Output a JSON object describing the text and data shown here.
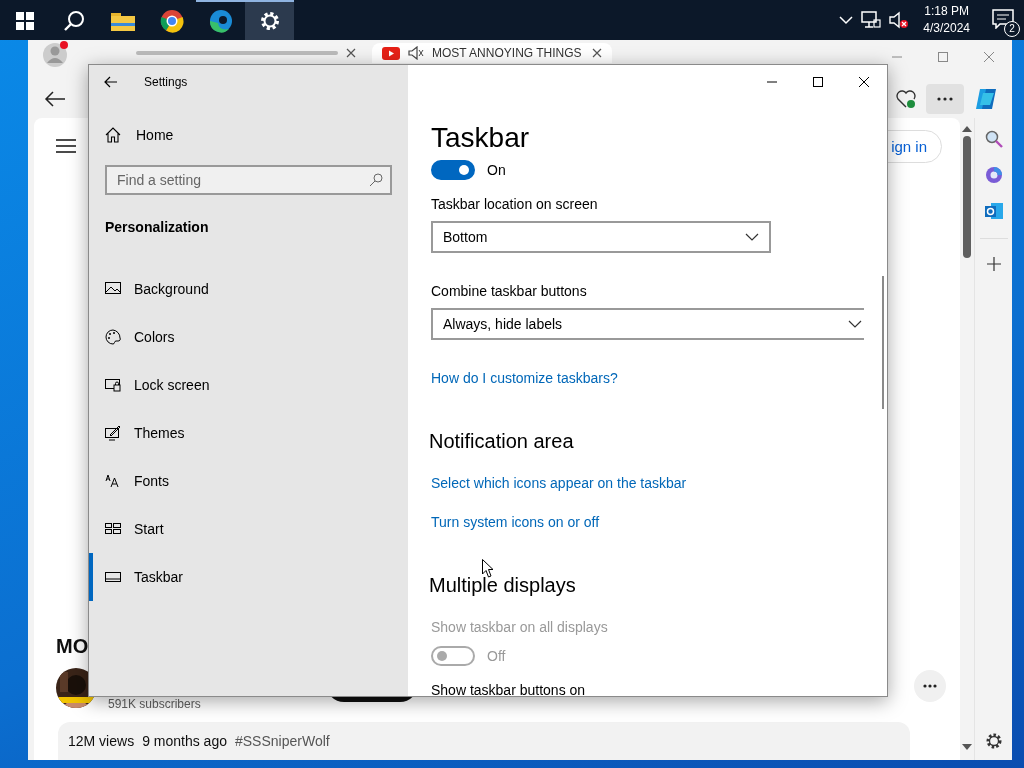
{
  "os_taskbar": {
    "apps": [
      {
        "kind": "start",
        "open": false,
        "active": false
      },
      {
        "kind": "search",
        "open": false,
        "active": false
      },
      {
        "kind": "folder",
        "open": false,
        "active": false
      },
      {
        "kind": "chrome",
        "open": false,
        "active": false
      },
      {
        "kind": "edge",
        "open": true,
        "active": false
      },
      {
        "kind": "settings",
        "open": true,
        "active": true
      }
    ],
    "clock": {
      "time": "1:18 PM",
      "date": "4/3/2024"
    },
    "notification_count": "2"
  },
  "browser": {
    "tabs": [
      {
        "kind": "blurred",
        "selected": false
      },
      {
        "kind": "video",
        "title": "MOST ANNOYING THINGS",
        "selected": true
      }
    ],
    "sign_in": "ign in",
    "heading": "MO",
    "channel": {
      "subscribers": "591K subscribers"
    },
    "description": {
      "views": "12M views",
      "age": "9 months ago",
      "hashtag": "#SSSniperWolf"
    }
  },
  "settings": {
    "title": "Settings",
    "home": "Home",
    "search_placeholder": "Find a setting",
    "section": "Personalization",
    "nav": [
      {
        "kind": "background",
        "label": "Background",
        "selected": false
      },
      {
        "kind": "colors",
        "label": "Colors",
        "selected": false
      },
      {
        "kind": "lock",
        "label": "Lock screen",
        "selected": false
      },
      {
        "kind": "themes",
        "label": "Themes",
        "selected": false
      },
      {
        "kind": "fonts",
        "label": "Fonts",
        "selected": false
      },
      {
        "kind": "start",
        "label": "Start",
        "selected": false
      },
      {
        "kind": "taskbar",
        "label": "Taskbar",
        "selected": true
      }
    ],
    "content": [
      {
        "kind": "title",
        "text": "Taskbar"
      },
      {
        "kind": "toggle",
        "on": true,
        "text": "On",
        "disabled": false
      },
      {
        "kind": "label",
        "text": "Taskbar location on screen",
        "disabled": false
      },
      {
        "kind": "dropdown",
        "value": "Bottom",
        "wide": false
      },
      {
        "kind": "label",
        "text": "Combine taskbar buttons",
        "disabled": false
      },
      {
        "kind": "dropdown",
        "value": "Always, hide labels",
        "wide": true
      },
      {
        "kind": "link",
        "text": "How do I customize taskbars?"
      },
      {
        "kind": "heading",
        "text": "Notification area"
      },
      {
        "kind": "link",
        "text": "Select which icons appear on the taskbar"
      },
      {
        "kind": "link",
        "text": "Turn system icons on or off"
      },
      {
        "kind": "heading",
        "text": "Multiple displays"
      },
      {
        "kind": "label",
        "text": "Show taskbar on all displays",
        "disabled": true
      },
      {
        "kind": "toggle",
        "on": false,
        "text": "Off",
        "disabled": true
      },
      {
        "kind": "label",
        "text": "Show taskbar buttons on",
        "disabled": false
      }
    ]
  }
}
